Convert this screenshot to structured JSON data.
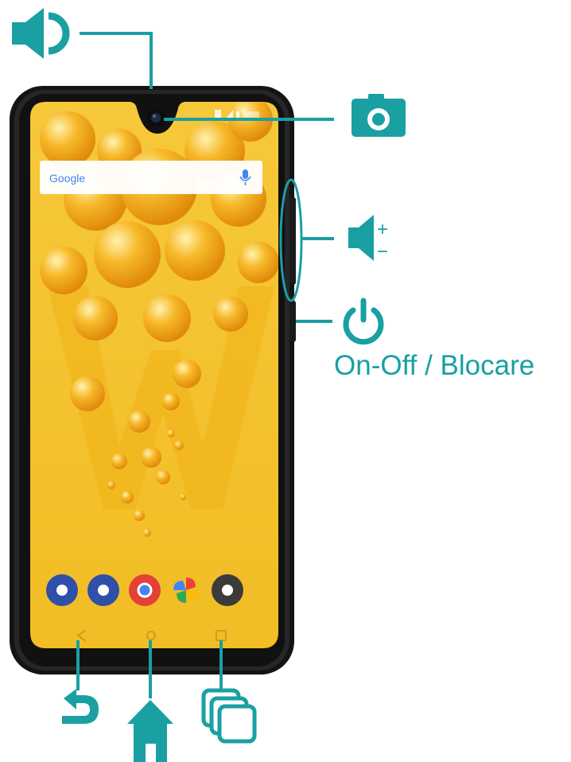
{
  "accent_color": "#1a9fa3",
  "phone": {
    "frame_color": "#1c1c1c",
    "wallpaper_color": "#f4c22b",
    "search_bar": {
      "logo_text": "Google",
      "icon": "microphone-icon"
    },
    "dock_apps": [
      {
        "name": "phone-app-icon",
        "color": "#2f4fa8"
      },
      {
        "name": "messages-app-icon",
        "color": "#2f4fa8"
      },
      {
        "name": "chrome-app-icon",
        "color": "#e44134"
      },
      {
        "name": "photos-app-icon",
        "color": "#fbbc05"
      },
      {
        "name": "camera-app-icon",
        "color": "#3b3b3b"
      }
    ]
  },
  "callouts": {
    "earpiece": {
      "icon": "speaker-icon"
    },
    "front_camera": {
      "icon": "camera-icon"
    },
    "volume": {
      "icon": "volume-plus-minus-icon",
      "plus": "+",
      "minus": "−"
    },
    "power": {
      "icon": "power-icon",
      "label": "On-Off / Blocare"
    },
    "back": {
      "icon": "back-arrow-icon"
    },
    "home": {
      "icon": "home-icon"
    },
    "recents": {
      "icon": "recent-apps-icon"
    }
  }
}
